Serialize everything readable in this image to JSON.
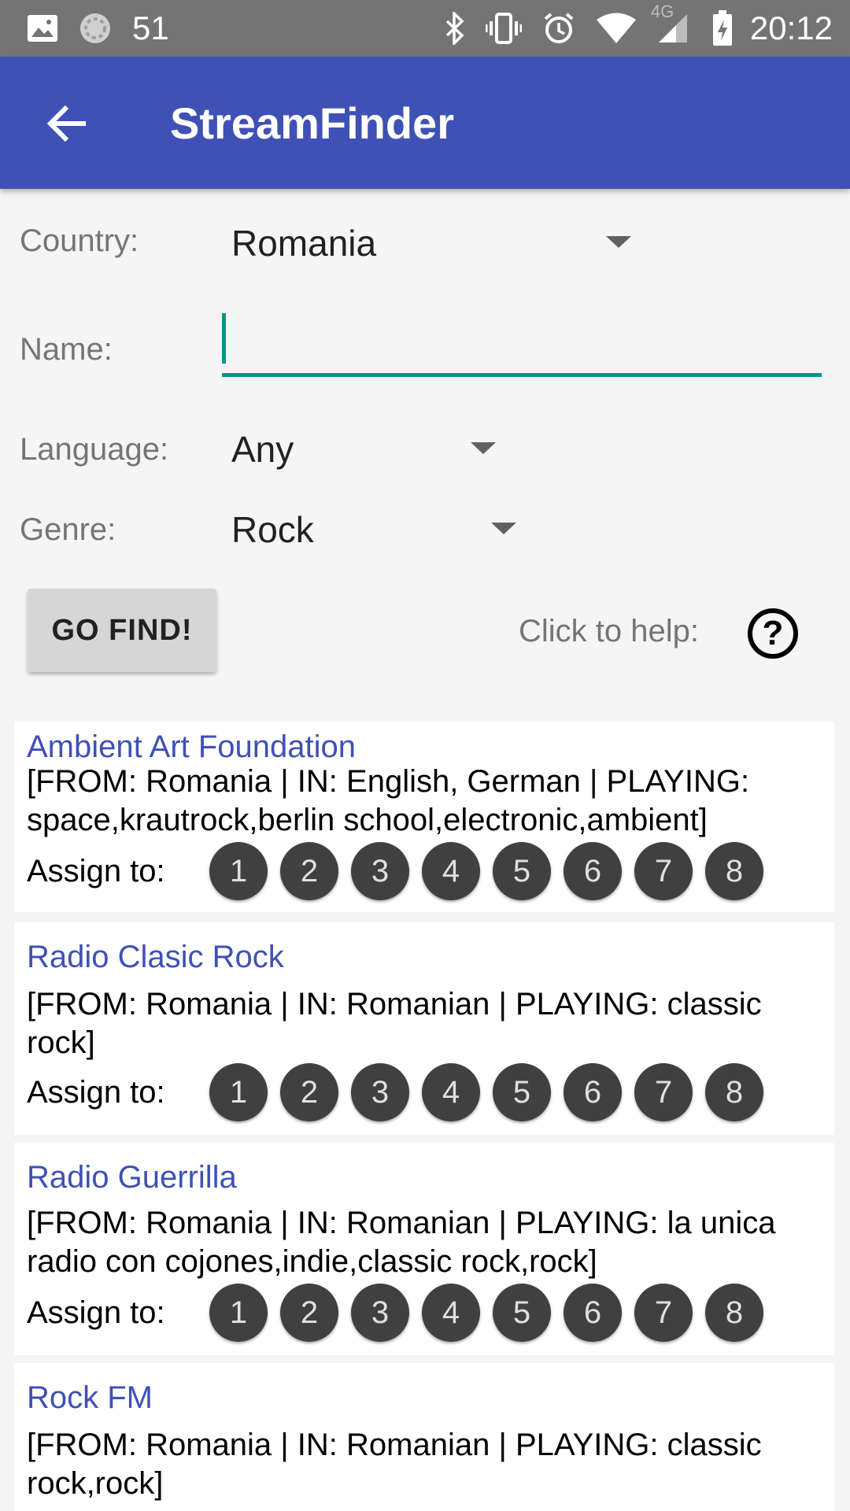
{
  "status_bar": {
    "notification_count": "51",
    "time": "20:12",
    "network": "4G",
    "icons": [
      "image-icon",
      "sync-icon",
      "bluetooth-icon",
      "vibrate-icon",
      "alarm-icon",
      "wifi-icon",
      "signal-icon",
      "battery-icon"
    ]
  },
  "app_bar": {
    "title": "StreamFinder",
    "back_icon": "arrow-left-icon",
    "color": "#3f51b5"
  },
  "form": {
    "country_label": "Country:",
    "country_value": "Romania",
    "name_label": "Name:",
    "name_value": "",
    "language_label": "Language:",
    "language_value": "Any",
    "genre_label": "Genre:",
    "genre_value": "Rock",
    "go_button": "GO FIND!",
    "help_label": "Click to help:",
    "help_icon": "?"
  },
  "results": [
    {
      "name": "Ambient Art Foundation",
      "details": "[FROM: Romania | IN: English, German | PLAYING: space,krautrock,berlin school,electronic,ambient]",
      "assign_label": "Assign to:",
      "slots": [
        "1",
        "2",
        "3",
        "4",
        "5",
        "6",
        "7",
        "8"
      ]
    },
    {
      "name": "Radio Clasic Rock",
      "details": "[FROM: Romania | IN: Romanian | PLAYING: classic rock]",
      "assign_label": "Assign to:",
      "slots": [
        "1",
        "2",
        "3",
        "4",
        "5",
        "6",
        "7",
        "8"
      ]
    },
    {
      "name": "Radio Guerrilla",
      "details": "[FROM: Romania | IN: Romanian | PLAYING: la unica radio con cojones,indie,classic rock,rock]",
      "assign_label": "Assign to:",
      "slots": [
        "1",
        "2",
        "3",
        "4",
        "5",
        "6",
        "7",
        "8"
      ]
    },
    {
      "name": "Rock FM",
      "details": "[FROM: Romania | IN: Romanian | PLAYING: classic rock,rock]"
    }
  ],
  "colors": {
    "accent": "#009688",
    "link": "#3f51b5",
    "slot": "#404040"
  }
}
